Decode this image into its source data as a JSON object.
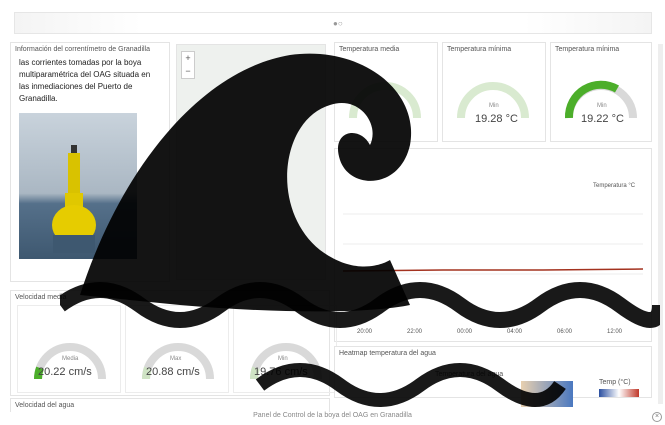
{
  "topbar": {
    "indicator": "●○"
  },
  "info": {
    "title": "Información del correntímetro de Granadilla",
    "text": "las corrientes tomadas por la boya multiparamétrica del OAG situada en las inmediaciones del Puerto de Granadilla."
  },
  "temp_media": {
    "title": "Temperatura media"
  },
  "temp_minima": {
    "title": "Temperatura mínima",
    "label": "Min",
    "value": "19.28 °C"
  },
  "temp_minima2": {
    "title": "Temperatura mínima",
    "label": "Min",
    "value": "19.22 °C"
  },
  "velocidad_media": {
    "title": "Velocidad media",
    "gauges": [
      {
        "label": "Media",
        "value": "20.22 cm/s"
      },
      {
        "label": "Max",
        "value": "20.88 cm/s"
      },
      {
        "label": "Min",
        "value": "19.76 cm/s"
      }
    ]
  },
  "temp_chart": {
    "legend": "Temperatura °C",
    "x_ticks": [
      "20:00",
      "22:00",
      "00:00",
      "04:00",
      "06:00",
      "12:00"
    ]
  },
  "heatmap": {
    "title": "Heatmap temperatura del agua",
    "subtitle": "Temperatura del agua",
    "legend_title": "Temp (°C)",
    "legend_min": "19.6",
    "legend_max": "20"
  },
  "velocidad_agua": {
    "title": "Velocidad del agua"
  },
  "footer": {
    "text": "Panel de Control de la boya del OAG en Granadilla"
  },
  "colors": {
    "gauge_fill": "#4cae2a",
    "gauge_track": "#d9d9d9",
    "line": "#a3321f"
  }
}
